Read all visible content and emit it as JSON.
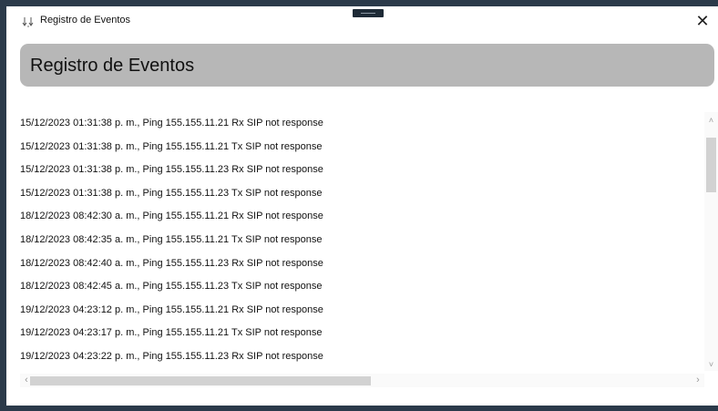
{
  "window": {
    "title": "Registro de Eventos",
    "close_glyph": "✕",
    "icon": "app-events-icon"
  },
  "header": {
    "title": "Registro de Eventos",
    "background_color": "#b7b7b7"
  },
  "log": {
    "lines": [
      "15/12/2023 01:31:38 p. m., Ping 155.155.11.21 Rx SIP not response",
      "15/12/2023 01:31:38 p. m., Ping 155.155.11.21 Tx SIP not response",
      "15/12/2023 01:31:38 p. m., Ping 155.155.11.23 Rx SIP not response",
      "15/12/2023 01:31:38 p. m., Ping 155.155.11.23 Tx SIP not response",
      "18/12/2023 08:42:30 a. m., Ping 155.155.11.21 Rx SIP not response",
      "18/12/2023 08:42:35 a. m., Ping 155.155.11.21 Tx SIP not response",
      "18/12/2023 08:42:40 a. m., Ping 155.155.11.23 Rx SIP not response",
      "18/12/2023 08:42:45 a. m., Ping 155.155.11.23 Tx SIP not response",
      "19/12/2023 04:23:12 p. m., Ping 155.155.11.21 Rx SIP not response",
      "19/12/2023 04:23:17 p. m., Ping 155.155.11.21 Tx SIP not response",
      "19/12/2023 04:23:22 p. m., Ping 155.155.11.23 Rx SIP not response"
    ]
  },
  "scrollbars": {
    "up_glyph": "˄",
    "down_glyph": "˅",
    "left_glyph": "‹",
    "right_glyph": "›"
  }
}
